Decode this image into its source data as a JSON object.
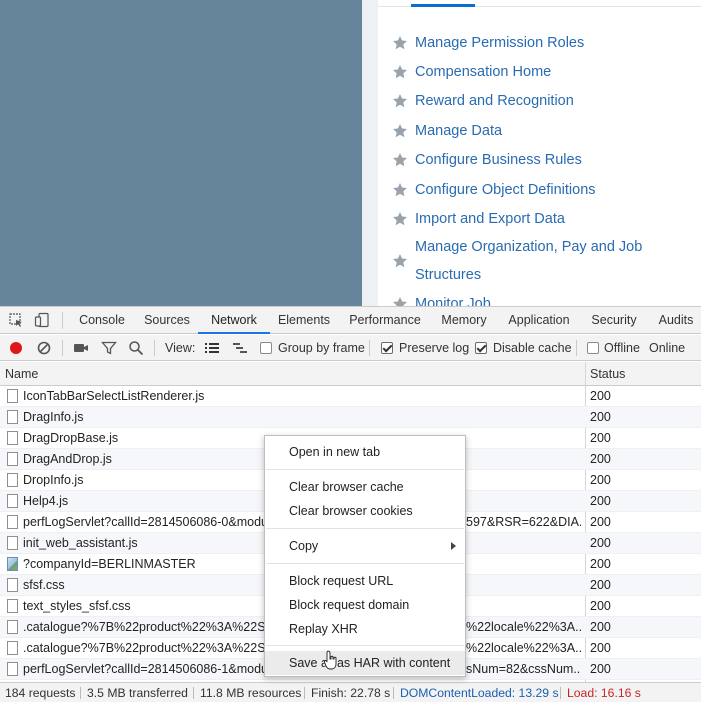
{
  "page": {
    "links": [
      {
        "label": "Manage Permission Roles"
      },
      {
        "label": "Compensation Home"
      },
      {
        "label": "Reward and Recognition"
      },
      {
        "label": "Manage Data"
      },
      {
        "label": "Configure Business Rules"
      },
      {
        "label": "Configure Object Definitions"
      },
      {
        "label": "Import and Export Data"
      },
      {
        "label": "Manage Organization, Pay and Job",
        "label2": "Structures"
      },
      {
        "label": "Monitor Job"
      }
    ],
    "colors": {
      "left_panel": "#66849a",
      "link": "#2a6bb1",
      "star": "#9aa3ab"
    }
  },
  "devtools": {
    "tabs": [
      "Console",
      "Sources",
      "Network",
      "Elements",
      "Performance",
      "Memory",
      "Application",
      "Security",
      "Audits"
    ],
    "active_tab": "Network",
    "toolbar": {
      "view_label": "View:",
      "group_by_frame": {
        "label": "Group by frame",
        "checked": false
      },
      "preserve_log": {
        "label": "Preserve log",
        "checked": true
      },
      "disable_cache": {
        "label": "Disable cache",
        "checked": true
      },
      "offline": {
        "label": "Offline",
        "checked": false
      },
      "throttle_value": "Online"
    },
    "columns": {
      "name": "Name",
      "status": "Status"
    },
    "rows": [
      {
        "name": "IconTabBarSelectListRenderer.js",
        "status": "200",
        "type": "file"
      },
      {
        "name": "DragInfo.js",
        "status": "200",
        "type": "file"
      },
      {
        "name": "DragDropBase.js",
        "status": "200",
        "type": "file"
      },
      {
        "name": "DragAndDrop.js",
        "status": "200",
        "type": "file"
      },
      {
        "name": "DropInfo.js",
        "status": "200",
        "type": "file"
      },
      {
        "name": "Help4.js",
        "status": "200",
        "type": "file"
      },
      {
        "name": "perfLogServlet?callId=2814506086-0&module",
        "name_tail": "597&RSR=622&DIA...",
        "status": "200",
        "type": "file"
      },
      {
        "name": "init_web_assistant.js",
        "status": "200",
        "type": "file"
      },
      {
        "name": "?companyId=BERLINMASTER",
        "status": "200",
        "type": "image"
      },
      {
        "name": "sfsf.css",
        "status": "200",
        "type": "file"
      },
      {
        "name": "text_styles_sfsf.css",
        "status": "200",
        "type": "file"
      },
      {
        "name": ".catalogue?%7B%22product%22%3A%22SFSF",
        "name_tail": "%22locale%22%3A...",
        "status": "200",
        "type": "file"
      },
      {
        "name": ".catalogue?%7B%22product%22%3A%22SFSF",
        "name_tail": "%22locale%22%3A...",
        "status": "200",
        "type": "file"
      },
      {
        "name": "perfLogServlet?callId=2814506086-1&module",
        "name_tail": "sNum=82&cssNum...",
        "status": "200",
        "type": "file"
      }
    ],
    "status_bar": {
      "requests": "184 requests",
      "transferred": "3.5 MB transferred",
      "resources": "11.8 MB resources",
      "finish": "Finish: 22.78 s",
      "dom_content_loaded": "DOMContentLoaded: 13.29 s",
      "load": "Load: 16.16 s",
      "dcl_color": "#1a5fb4",
      "load_color": "#c62828"
    },
    "context_menu": {
      "items": [
        {
          "label": "Open in new tab"
        },
        {
          "label": "Clear browser cache"
        },
        {
          "label": "Clear browser cookies"
        },
        {
          "label": "Copy",
          "submenu": true
        },
        {
          "label": "Block request URL"
        },
        {
          "label": "Block request domain"
        },
        {
          "label": "Replay XHR"
        },
        {
          "label": "Save all as HAR with content",
          "hovered": true
        }
      ]
    },
    "icons": [
      "inspect-element-icon",
      "device-toolbar-icon",
      "record-icon",
      "clear-icon",
      "camera-icon",
      "filter-icon",
      "search-icon",
      "large-rows-icon",
      "waterfall-icon"
    ]
  }
}
